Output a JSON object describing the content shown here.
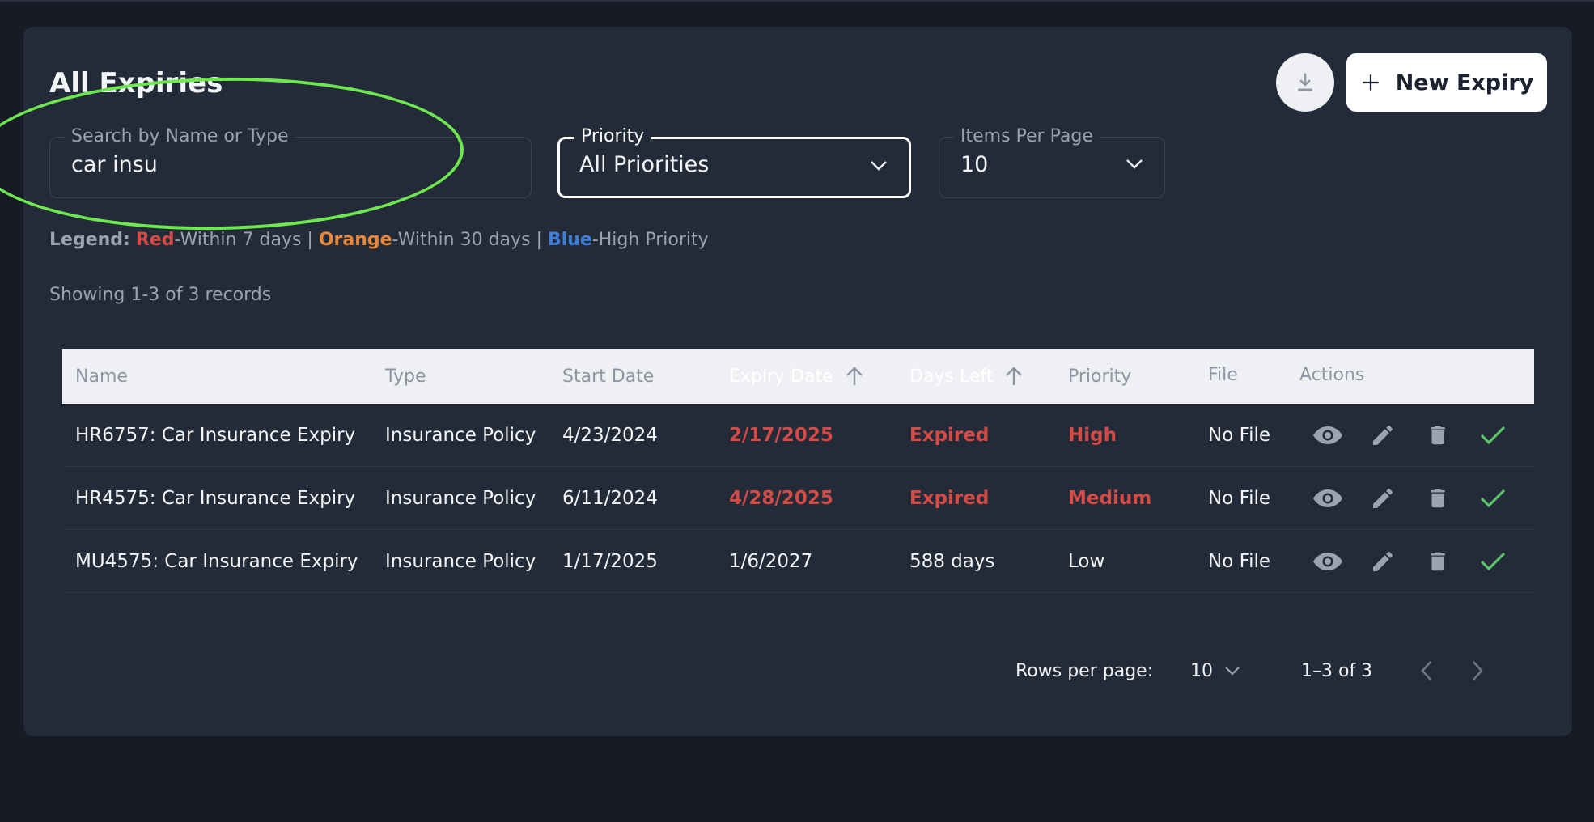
{
  "header": {
    "title": "All Expiries",
    "download_icon": "download-icon",
    "new_button_label": "New Expiry"
  },
  "filters": {
    "search": {
      "label": "Search by Name or Type",
      "value": "car insu"
    },
    "priority": {
      "label": "Priority",
      "value": "All Priorities"
    },
    "per_page": {
      "label": "Items Per Page",
      "value": "10"
    }
  },
  "legend": {
    "prefix": "Legend:",
    "red": "Red",
    "red_text": "-Within 7 days |",
    "orange": "Orange",
    "orange_text": "-Within 30 days |",
    "blue": "Blue",
    "blue_text": "-High Priority"
  },
  "showing": "Showing 1-3 of 3 records",
  "table": {
    "columns": [
      "Name",
      "Type",
      "Start Date",
      "Expiry Date",
      "Days Left",
      "Priority",
      "File",
      "Actions"
    ],
    "rows": [
      {
        "name": "HR6757: Car Insurance Expiry",
        "type": "Insurance Policy",
        "start": "4/23/2024",
        "expiry": "2/17/2025",
        "days_left": "Expired",
        "priority": "High",
        "file": "No File"
      },
      {
        "name": "HR4575: Car Insurance Expiry",
        "type": "Insurance Policy",
        "start": "6/11/2024",
        "expiry": "4/28/2025",
        "days_left": "Expired",
        "priority": "Medium",
        "file": "No File"
      },
      {
        "name": "MU4575: Car Insurance Expiry",
        "type": "Insurance Policy",
        "start": "1/17/2025",
        "expiry": "1/6/2027",
        "days_left": "588 days",
        "priority": "Low",
        "file": "No File"
      }
    ]
  },
  "pagination": {
    "rows_per_page_label": "Rows per page:",
    "rows_per_page_value": "10",
    "range": "1–3 of 3"
  },
  "colors": {
    "red": "#d44a45",
    "orange": "#e8883a",
    "blue": "#3f7fd9",
    "green_check": "#5cc26b",
    "highlight": "#6ee84f"
  }
}
